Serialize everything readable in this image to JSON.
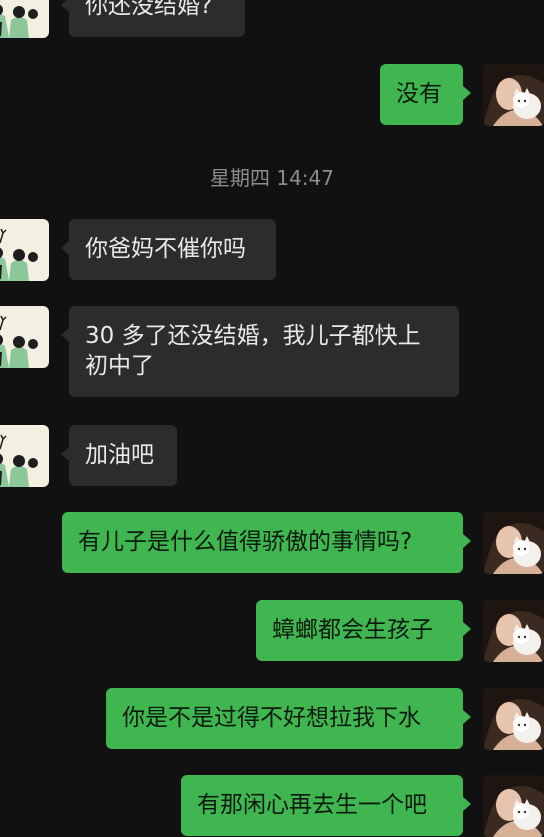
{
  "timestamp": "星期四 14:47",
  "messages": [
    {
      "text": "你还没结婚?"
    },
    {
      "text": "没有"
    },
    {
      "text": "你爸妈不催你吗"
    },
    {
      "text": "30 多了还没结婚，我儿子都快上\n初中了"
    },
    {
      "text": "加油吧"
    },
    {
      "text": "有儿子是什么值得骄傲的事情吗?"
    },
    {
      "text": "蟑螂都会生孩子"
    },
    {
      "text": "你是不是过得不好想拉我下水"
    },
    {
      "text": "有那闲心再去生一个吧"
    }
  ]
}
